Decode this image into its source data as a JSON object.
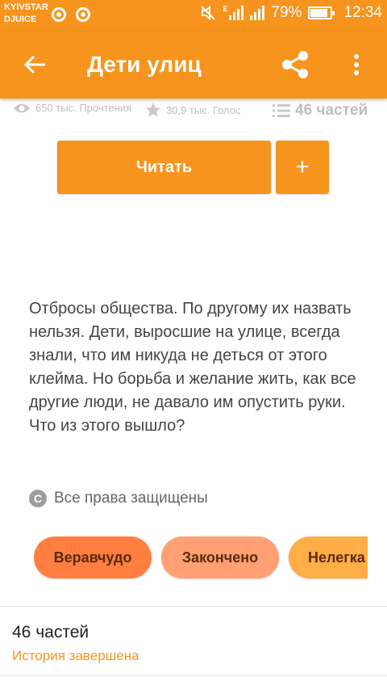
{
  "status_bar": {
    "carrier_line1": "KYIVSTAR",
    "carrier_line2": "DJUICE",
    "network": "E",
    "battery": "79%",
    "time": "12:34"
  },
  "app_bar": {
    "title": "Дети улиц",
    "icons": [
      "back-arrow-icon",
      "share-icon",
      "more-vert-icon"
    ]
  },
  "stats": {
    "reads": "650 тыс. Прочтения",
    "votes": "30,9 тыс. Голос",
    "parts": "46 частей"
  },
  "actions": {
    "read_label": "Читать",
    "add_label": "+"
  },
  "description": "Отбросы общества. По другому их назвать нельзя. Дети, выросшие на улице, всегда знали, что им никуда не деться от этого клейма. Но борьба и желание жить, как все другие люди, не давало им опустить руки. Что из этого вышло?",
  "copyright": {
    "icon": "C",
    "text": "Все права защищены"
  },
  "tags": [
    {
      "label": "Веравчудо",
      "color": "#ff7e40"
    },
    {
      "label": "Закончено",
      "color": "#ff9f73"
    },
    {
      "label": "Нелегка",
      "color": "#ffad45"
    }
  ],
  "parts_section": {
    "title": "46 частей",
    "status": "История завершена"
  },
  "colors": {
    "accent": "#f7941d",
    "status_text": "#f7941d"
  }
}
